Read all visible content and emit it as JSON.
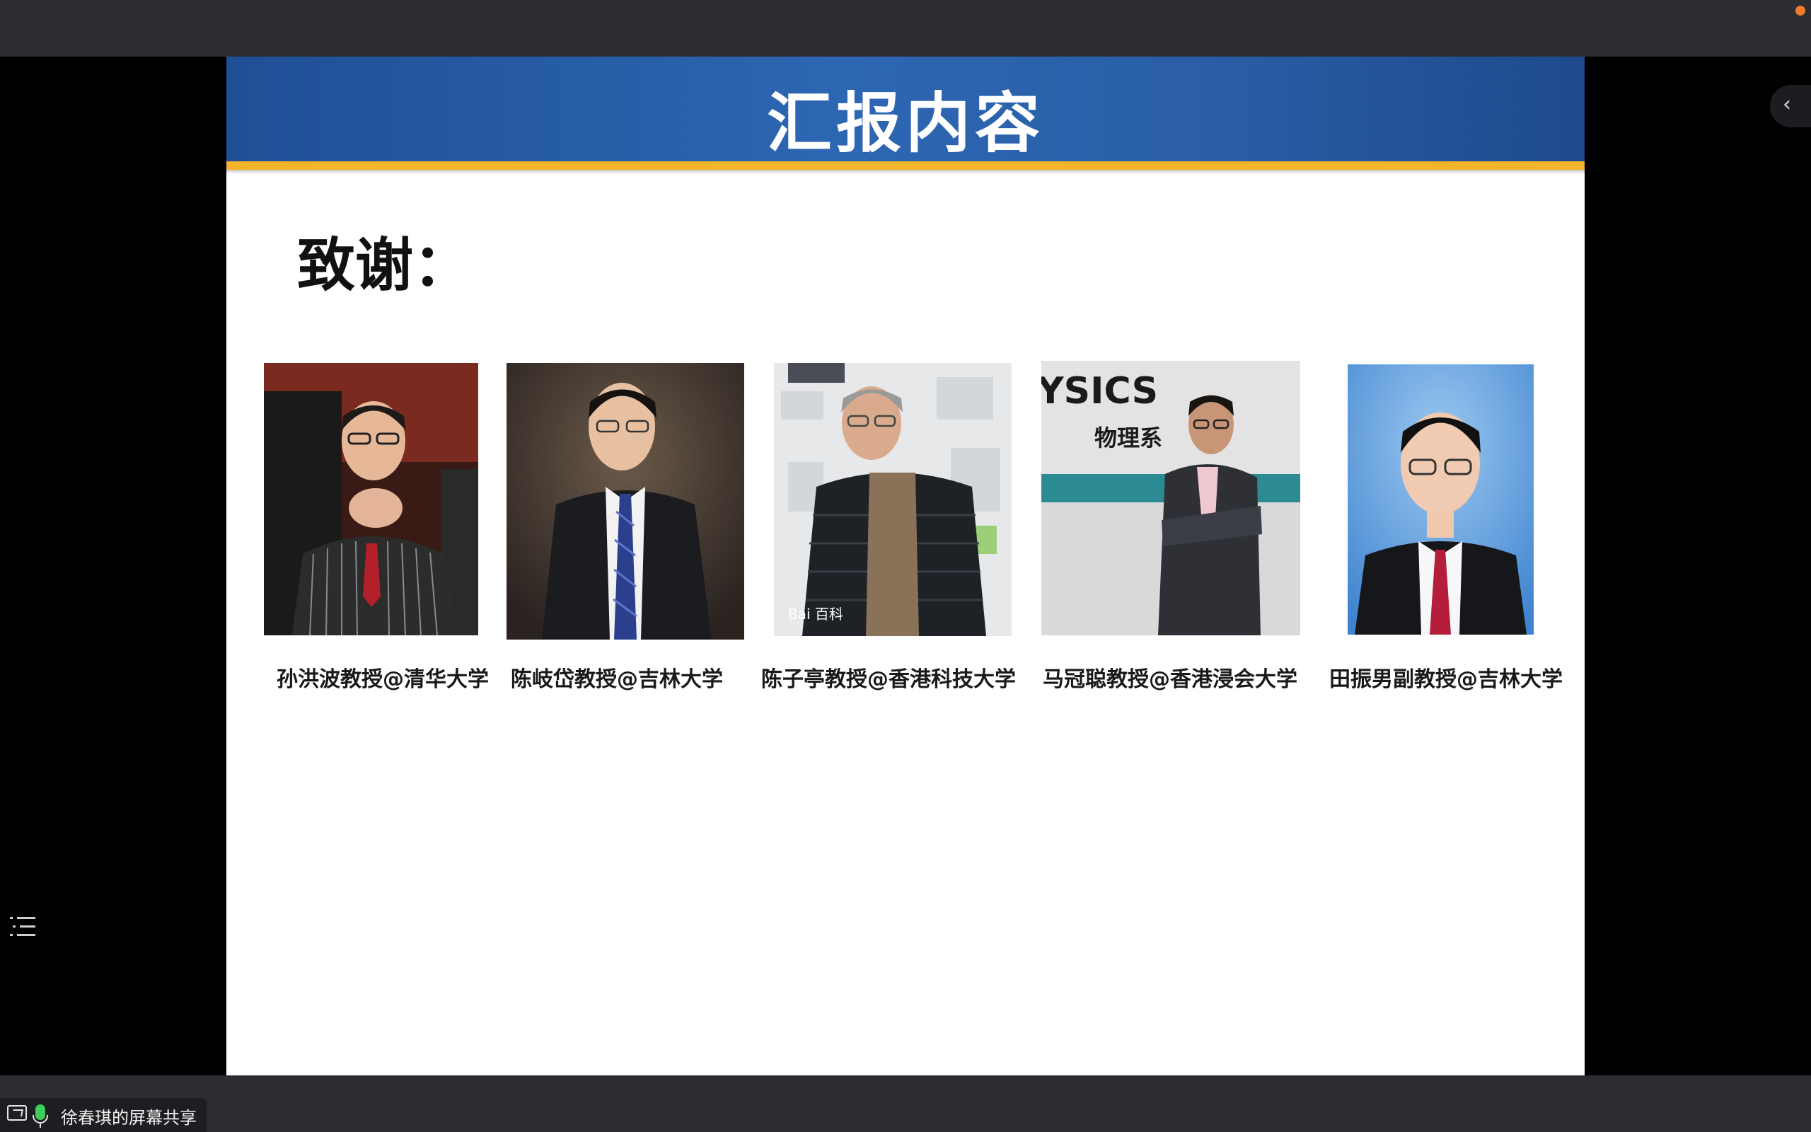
{
  "window": {
    "recording_indicator_color": "#f07a2e"
  },
  "slide": {
    "title": "汇报内容",
    "subtitle": "致谢：",
    "header_color": "#2a5fa8",
    "accent_color": "#f3b52b",
    "people": [
      {
        "caption": "孙洪波教授@清华大学"
      },
      {
        "caption": "陈岐岱教授@吉林大学"
      },
      {
        "caption": "陈子亭教授@香港科技大学"
      },
      {
        "caption": "马冠聪教授@香港浸会大学"
      },
      {
        "caption": "田振男副教授@吉林大学"
      }
    ],
    "photo3_text": {
      "watermark": "Bai 百科"
    },
    "photo4_text": {
      "wall_line1": "YSICS",
      "wall_line2": "物理系"
    }
  },
  "side_panel": {
    "toggle_icon": "chevron-left-icon",
    "toggle_glyph": "‹"
  },
  "toc": {
    "icon": "list-icon"
  },
  "bottom": {
    "share_label": "徐春琪的屏幕共享"
  }
}
